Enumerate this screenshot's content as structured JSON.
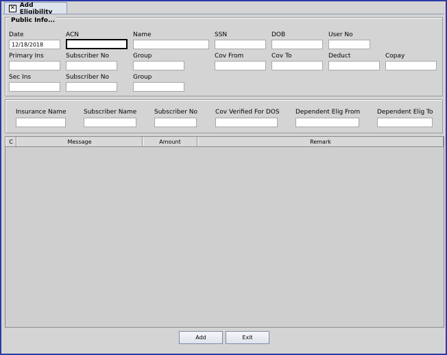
{
  "tab": {
    "close_glyph": "✕",
    "title": "Add Eligibility"
  },
  "public_info": {
    "legend": "Public Info...",
    "row1": {
      "date_label": "Date",
      "date_value": "12/18/2018",
      "acn_label": "ACN",
      "acn_value": "",
      "name_label": "Name",
      "name_value": "",
      "ssn_label": "SSN",
      "ssn_value": "",
      "dob_label": "DOB",
      "dob_value": "",
      "userno_label": "User No",
      "userno_value": ""
    },
    "row2": {
      "primary_ins_label": "Primary Ins",
      "subscriber_no_label": "Subscriber No",
      "group_label": "Group",
      "cov_from_label": "Cov From",
      "cov_to_label": "Cov To",
      "deduct_label": "Deduct",
      "copay_label": "Copay"
    },
    "row3": {
      "sec_ins_label": "Sec Ins",
      "subscriber_no_label": "Subscriber No",
      "group_label": "Group"
    }
  },
  "insurance_info": {
    "insurance_name_label": "Insurance Name",
    "subscriber_name_label": "Subscriber Name",
    "subscriber_no_label": "Subscriber No",
    "cov_verified_label": "Cov Verified For DOS",
    "dep_elig_from_label": "Dependent Elig From",
    "dep_elig_to_label": "Dependent Elig To"
  },
  "table": {
    "columns": [
      "C",
      "Message",
      "Amount",
      "Remark"
    ],
    "rows": []
  },
  "buttons": {
    "add": "Add",
    "exit": "Exit"
  },
  "colors": {
    "window_border": "#2b3aa6",
    "panel_bg": "#d4d4d4"
  }
}
